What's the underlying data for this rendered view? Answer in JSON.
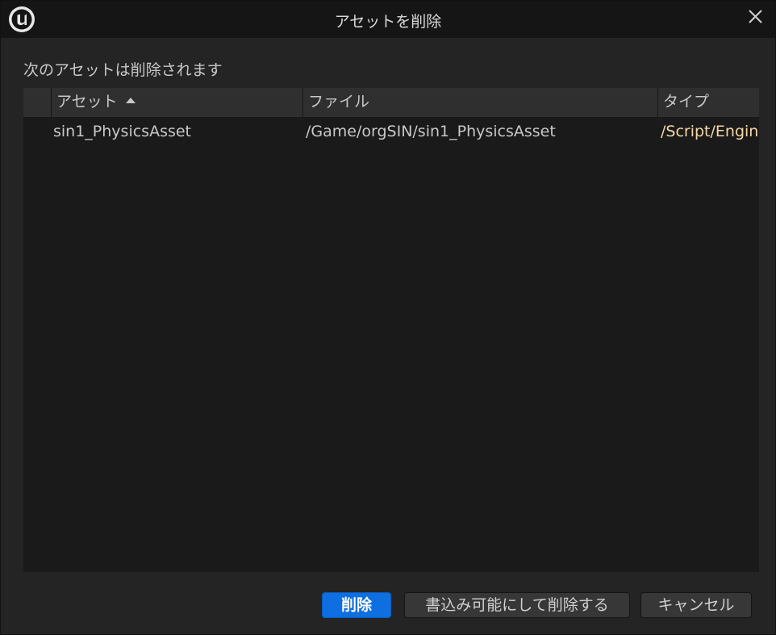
{
  "window": {
    "title": "アセットを削除"
  },
  "subtitle": "次のアセットは削除されます",
  "table": {
    "columns": [
      {
        "label": ""
      },
      {
        "label": "アセット"
      },
      {
        "label": "ファイル"
      },
      {
        "label": "タイプ"
      }
    ],
    "sort": {
      "column": "アセット",
      "direction": "ascending"
    },
    "rows": [
      {
        "asset": "sin1_PhysicsAsset",
        "file": "/Game/orgSIN/sin1_PhysicsAsset",
        "type": "/Script/Engin"
      }
    ]
  },
  "buttons": {
    "delete": "削除",
    "force_delete": "書込み可能にして削除する",
    "cancel": "キャンセル"
  },
  "icons": {
    "app_logo": "unreal-engine-logo-icon",
    "close": "close-icon",
    "sort": "sort-ascending-icon"
  },
  "colors": {
    "accent": "#0f6fe0",
    "type_text": "#f5d7a8"
  }
}
